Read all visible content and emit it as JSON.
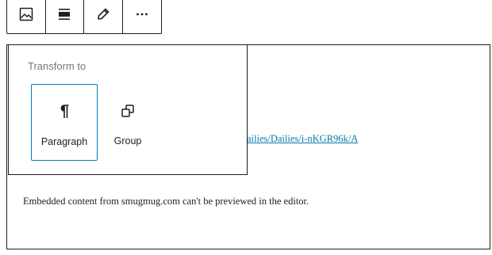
{
  "toolbar": {
    "buttons": [
      {
        "icon": "image-icon"
      },
      {
        "icon": "align-icon"
      },
      {
        "icon": "pencil-icon"
      },
      {
        "icon": "more-options-icon"
      }
    ]
  },
  "transform": {
    "title": "Transform to",
    "items": [
      {
        "label": "Paragraph",
        "icon": "pilcrow-icon",
        "selected": true
      },
      {
        "label": "Group",
        "icon": "group-icon",
        "selected": false
      }
    ]
  },
  "embed": {
    "url_visible": "ailies/Dailies/i-nKGR96k/A",
    "note": "Embedded content from smugmug.com can't be previewed in the editor."
  },
  "colors": {
    "border": "#1e1e1e",
    "accent": "#007cba",
    "link": "#0b7aa8",
    "muted": "#757575"
  }
}
